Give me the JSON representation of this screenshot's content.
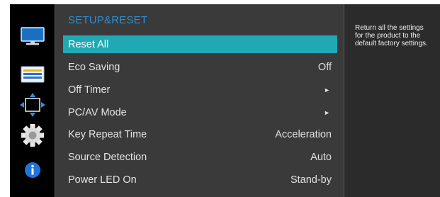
{
  "menu": {
    "title": "SETUP&RESET",
    "items": [
      {
        "label": "Reset All",
        "value": "",
        "submenu": false,
        "selected": true
      },
      {
        "label": "Eco Saving",
        "value": "Off",
        "submenu": false,
        "selected": false
      },
      {
        "label": "Off Timer",
        "value": "",
        "submenu": true,
        "selected": false
      },
      {
        "label": "PC/AV Mode",
        "value": "",
        "submenu": true,
        "selected": false
      },
      {
        "label": "Key Repeat Time",
        "value": "Acceleration",
        "submenu": false,
        "selected": false
      },
      {
        "label": "Source Detection",
        "value": "Auto",
        "submenu": false,
        "selected": false
      },
      {
        "label": "Power LED On",
        "value": "Stand-by",
        "submenu": false,
        "selected": false
      }
    ],
    "submenu_arrow": "►"
  },
  "help": {
    "text": "Return all the settings\nfor the product to the\ndefault factory settings."
  },
  "nav_icons": [
    "picture-icon",
    "onscreen-display-icon",
    "position-arrows-icon",
    "gear-icon",
    "info-icon"
  ],
  "colors": {
    "selection": "#1fa9b4",
    "title": "#2a8fd6",
    "nav_background": "#000000",
    "panel_background": "#3a3a3a"
  }
}
